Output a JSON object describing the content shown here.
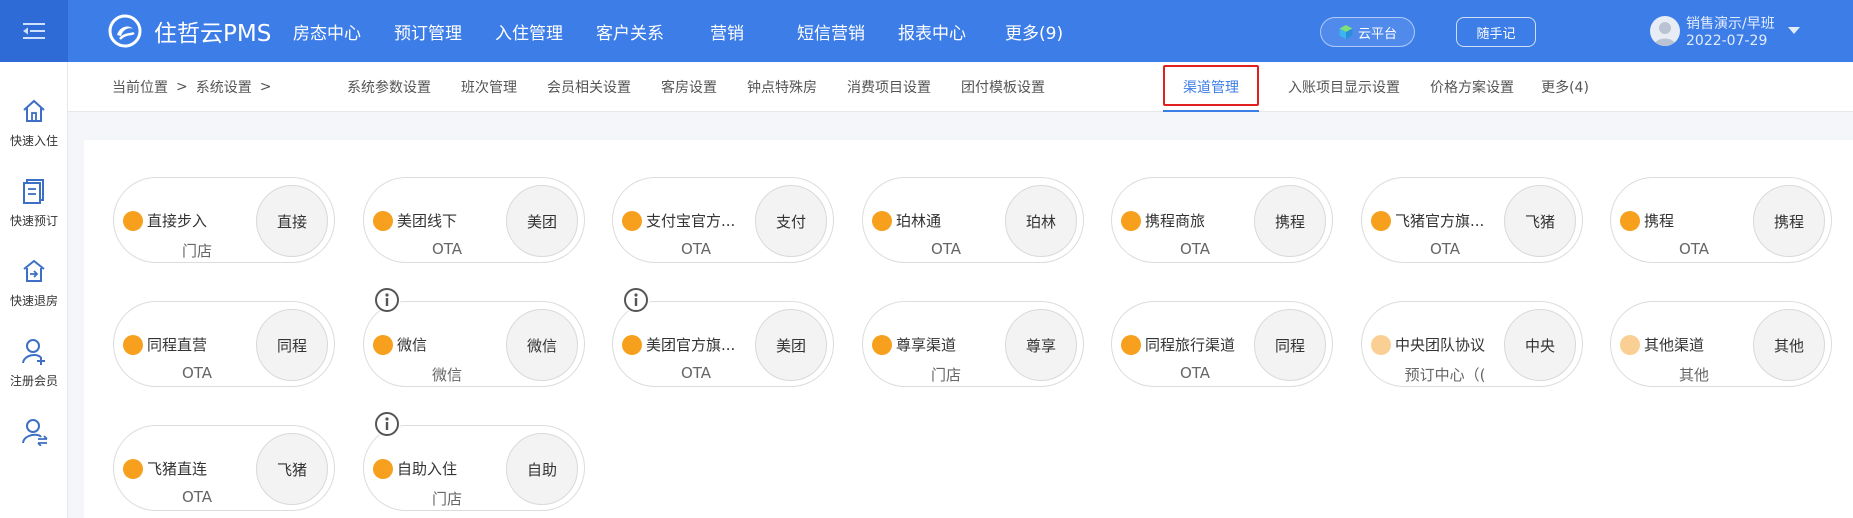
{
  "app": {
    "logo_text": "住哲云PMS"
  },
  "nav": [
    {
      "label": "房态中心"
    },
    {
      "label": "预订管理"
    },
    {
      "label": "入住管理"
    },
    {
      "label": "客户关系"
    },
    {
      "label": "营销"
    },
    {
      "label": "短信营销"
    },
    {
      "label": "报表中心"
    },
    {
      "label": "更多(9)"
    }
  ],
  "header": {
    "cloud_label": "云平台",
    "note_label": "随手记",
    "user_name": "销售演示/早班",
    "user_date": "2022-07-29"
  },
  "sidebar": [
    {
      "label": "快速入住",
      "icon": "home-icon"
    },
    {
      "label": "快速预订",
      "icon": "booking-icon"
    },
    {
      "label": "快速退房",
      "icon": "checkout-icon"
    },
    {
      "label": "注册会员",
      "icon": "add-member-icon"
    },
    {
      "label": "",
      "icon": "member-swap-icon"
    }
  ],
  "breadcrumb": {
    "prefix": "当前位置",
    "sep1": ">",
    "section": "系统设置",
    "sep2": ">"
  },
  "subtabs": [
    {
      "label": "系统参数设置"
    },
    {
      "label": "班次管理"
    },
    {
      "label": "会员相关设置"
    },
    {
      "label": "客房设置"
    },
    {
      "label": "钟点特殊房"
    },
    {
      "label": "消费项目设置"
    },
    {
      "label": "团付模板设置"
    },
    {
      "label": "渠道管理",
      "active": true
    },
    {
      "label": "入账项目显示设置"
    },
    {
      "label": "价格方案设置"
    },
    {
      "label": "更多(4)"
    }
  ],
  "channels": [
    {
      "name": "直接步入",
      "type": "门店",
      "short": "直接",
      "dot": "normal",
      "info": false
    },
    {
      "name": "美团线下",
      "type": "OTA",
      "short": "美团",
      "dot": "normal",
      "info": false
    },
    {
      "name": "支付宝官方...",
      "type": "OTA",
      "short": "支付",
      "dot": "normal",
      "info": false
    },
    {
      "name": "珀林通",
      "type": "OTA",
      "short": "珀林",
      "dot": "normal",
      "info": false
    },
    {
      "name": "携程商旅",
      "type": "OTA",
      "short": "携程",
      "dot": "normal",
      "info": false
    },
    {
      "name": "飞猪官方旗...",
      "type": "OTA",
      "short": "飞猪",
      "dot": "normal",
      "info": false
    },
    {
      "name": "携程",
      "type": "OTA",
      "short": "携程",
      "dot": "normal",
      "info": false
    },
    {
      "name": "同程直营",
      "type": "OTA",
      "short": "同程",
      "dot": "normal",
      "info": false
    },
    {
      "name": "微信",
      "type": "微信",
      "short": "微信",
      "dot": "normal",
      "info": true
    },
    {
      "name": "美团官方旗...",
      "type": "OTA",
      "short": "美团",
      "dot": "normal",
      "info": true
    },
    {
      "name": "尊享渠道",
      "type": "门店",
      "short": "尊享",
      "dot": "normal",
      "info": false
    },
    {
      "name": "同程旅行渠道",
      "type": "OTA",
      "short": "同程",
      "dot": "normal",
      "info": false
    },
    {
      "name": "中央团队协议",
      "type": "预订中心（(",
      "short": "中央",
      "dot": "light",
      "info": false
    },
    {
      "name": "其他渠道",
      "type": "其他",
      "short": "其他",
      "dot": "light",
      "info": false
    },
    {
      "name": "飞猪直连",
      "type": "OTA",
      "short": "飞猪",
      "dot": "normal",
      "info": false
    },
    {
      "name": "自助入住",
      "type": "门店",
      "short": "自助",
      "dot": "normal",
      "info": true
    }
  ],
  "colors": {
    "brand": "#3d7de8",
    "dot": "#f7a01e",
    "dot_light": "#f9cf94",
    "active_outline": "#e02020"
  }
}
